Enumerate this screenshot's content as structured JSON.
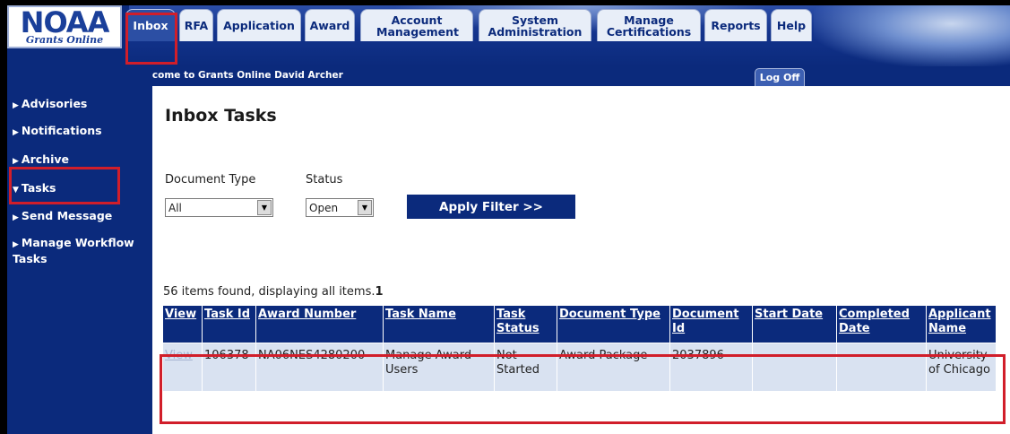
{
  "logo": {
    "main": "NOAA",
    "sub": "Grants Online"
  },
  "tabs": [
    {
      "label": "Inbox",
      "active": true
    },
    {
      "label": "RFA"
    },
    {
      "label": "Application"
    },
    {
      "label": "Award"
    },
    {
      "label": "Account Management"
    },
    {
      "label": "System Administration"
    },
    {
      "label": "Manage Certifications"
    },
    {
      "label": "Reports"
    },
    {
      "label": "Help"
    }
  ],
  "header": {
    "welcome": "Welcome to Grants Online David Archer",
    "logoff": "Log Off"
  },
  "sidebar": {
    "items": [
      {
        "label": "Advisories"
      },
      {
        "label": "Notifications"
      },
      {
        "label": "Archive"
      },
      {
        "label": "Tasks",
        "expanded": true
      },
      {
        "label": "Send Message"
      },
      {
        "label": "Manage Workflow Tasks"
      }
    ]
  },
  "main": {
    "title": "Inbox Tasks",
    "filters": {
      "document_type_label": "Document Type",
      "document_type_value": "All",
      "status_label": "Status",
      "status_value": "Open",
      "apply_label": "Apply Filter >>"
    },
    "summary": "56 items found, displaying all items.",
    "page_number": "1",
    "table": {
      "headers": [
        "View",
        "Task Id",
        "Award Number",
        "Task Name",
        "Task Status",
        "Document Type",
        "Document Id",
        "Start Date",
        "Completed Date",
        "Applicant Name"
      ],
      "rows": [
        {
          "view": "View",
          "task_id": "106378",
          "award_number": "NA06NES4280200",
          "task_name": "Manage Award Users",
          "task_status": "Not Started",
          "document_type": "Award Package",
          "document_id": "2037896",
          "start_date": "",
          "completed_date": "",
          "applicant_name": "University of Chicago"
        }
      ]
    }
  },
  "colors": {
    "navy": "#0b2a7c",
    "highlight": "#d11e2a",
    "row_bg": "#d9e2f1"
  }
}
